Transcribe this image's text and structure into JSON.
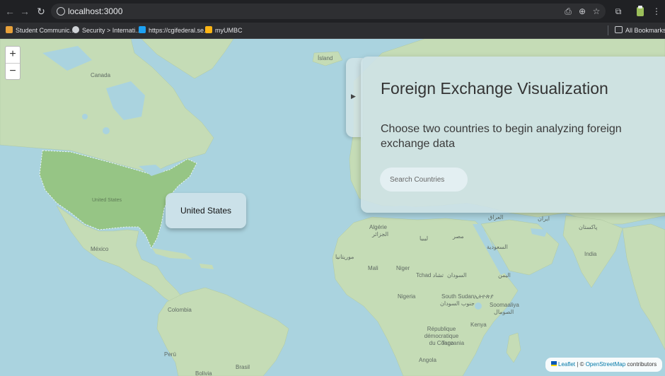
{
  "browser": {
    "url": "localhost:3000",
    "bookmarks": [
      {
        "label": "Student Communic...",
        "icon": "bookmark-favicon-student",
        "color": "#e8a13a"
      },
      {
        "label": "Security > Internati...",
        "icon": "bookmark-favicon-security",
        "color": "#cfd2d6"
      },
      {
        "label": "https://cgifederal.se...",
        "icon": "bookmark-favicon-cgi",
        "color": "#1da1f2"
      },
      {
        "label": "myUMBC",
        "icon": "bookmark-favicon-umbc",
        "color": "#fdb515"
      }
    ],
    "all_bookmarks": "All Bookmarks"
  },
  "map": {
    "zoom_in": "+",
    "zoom_out": "−",
    "labels": {
      "canada": "Canada",
      "united_states": "United States",
      "mexico": "México",
      "colombia": "Colombia",
      "peru": "Perú",
      "bolivia": "Bolivia",
      "brasil": "Brasil",
      "island": "Ísland",
      "algerie": "Algérie",
      "algerie_ar": "الجزائر",
      "libya": "ليبيا",
      "egypt": "مصر",
      "mali": "Mali",
      "niger": "Niger",
      "mauritania": "موريتانيا",
      "tchad": "Tchad تشاد",
      "sudan": "السودان",
      "saudi": "السعودية",
      "iraq": "العراق",
      "yemen": "اليمن",
      "nigeria": "Nigeria",
      "south_sudan": "South Sudan",
      "ethiopia": "ኢትዮጵያ",
      "south_sudan_ar": "جنوب السودان",
      "somalia": "Soomaaliya",
      "somalia_ar": "الصومال",
      "kenya": "Kenya",
      "drc": "République démocratique du Congo",
      "tanzania": "Tanzania",
      "angola": "Angola",
      "india": "India",
      "pakistan": "پاکستان",
      "iran": "ایران"
    },
    "tooltip": "United States",
    "attribution": {
      "leaflet": "Leaflet",
      "sep": "| ©",
      "osm": "OpenStreetMap",
      "contributors": "contributors"
    },
    "colors": {
      "water": "#aad3df",
      "land": "#c5dcb6",
      "highlight": "#96c585"
    }
  },
  "panel": {
    "title": "Foreign Exchange Visualization",
    "subtitle": "Choose two countries to begin analyzing foreign exchange data",
    "search_placeholder": "Search Countries",
    "toggle_icon": "expand-arrow-icon"
  }
}
